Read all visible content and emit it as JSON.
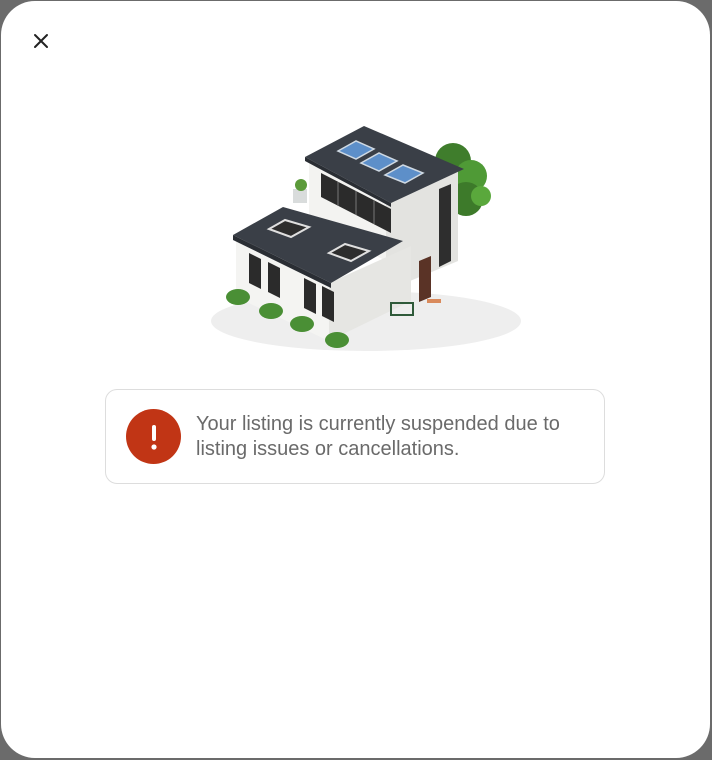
{
  "modal": {
    "close_icon": "close-icon",
    "illustration": "house-illustration"
  },
  "alert": {
    "icon": "exclamation-icon",
    "icon_color": "#c13515",
    "message": "Your listing is currently suspended due to listing issues or cancellations."
  }
}
